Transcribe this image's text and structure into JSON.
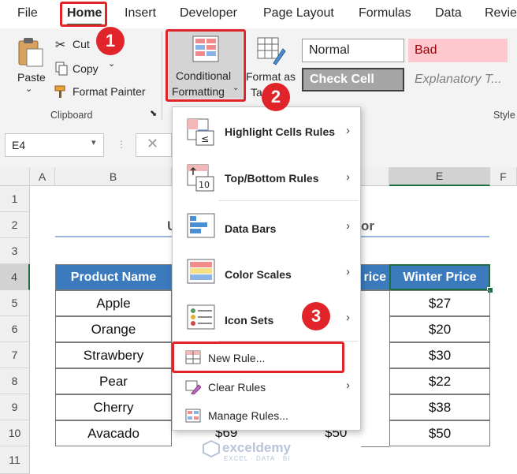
{
  "tabs": [
    "File",
    "Home",
    "Insert",
    "Developer",
    "Page Layout",
    "Formulas",
    "Data",
    "Revie"
  ],
  "ribbon": {
    "paste": "Paste",
    "cut": "Cut",
    "copy": "Copy",
    "format_painter": "Format Painter",
    "clipboard_group": "Clipboard",
    "cond_fmt_line1": "Conditional",
    "cond_fmt_line2": "Formatting",
    "format_as_line1": "Format as",
    "format_as_line2": "Ta",
    "styles": {
      "normal": "Normal",
      "bad": "Bad",
      "check_cell": "Check Cell",
      "explanatory": "Explanatory T..."
    },
    "style_group": "Style"
  },
  "formula_bar": {
    "name_box": "E4"
  },
  "grid": {
    "columns": [
      "A",
      "B",
      "E",
      "F"
    ],
    "rows": [
      "1",
      "2",
      "3",
      "4",
      "5",
      "6",
      "7",
      "8",
      "9",
      "10",
      "11"
    ],
    "title_fragment_left": "U",
    "title_fragment_right": "or",
    "headers": {
      "product": "Product Name",
      "price_fragment": "rice",
      "winter": "Winter Price"
    },
    "products": [
      "Apple",
      "Orange",
      "Strawbery",
      "Pear",
      "Cherry",
      "Avacado"
    ],
    "winter_prices": [
      "$27",
      "$20",
      "$30",
      "$22",
      "$38",
      "$50"
    ],
    "last_row_partial": {
      "col_c": "$69",
      "col_d": "$50"
    }
  },
  "menu": {
    "highlight": "Highlight Cells Rules",
    "topbottom": "Top/Bottom Rules",
    "databars": "Data Bars",
    "colorscales": "Color Scales",
    "iconsets": "Icon Sets",
    "newrule": "New Rule...",
    "clearrules": "Clear Rules",
    "managerules": "Manage Rules..."
  },
  "badges": [
    "1",
    "2",
    "3"
  ],
  "watermark": {
    "name": "exceldemy",
    "tagline": "EXCEL · DATA · BI"
  },
  "colors": {
    "accent_red": "#e0242a",
    "header_blue": "#3a7abd",
    "excel_green": "#1d6f42"
  }
}
